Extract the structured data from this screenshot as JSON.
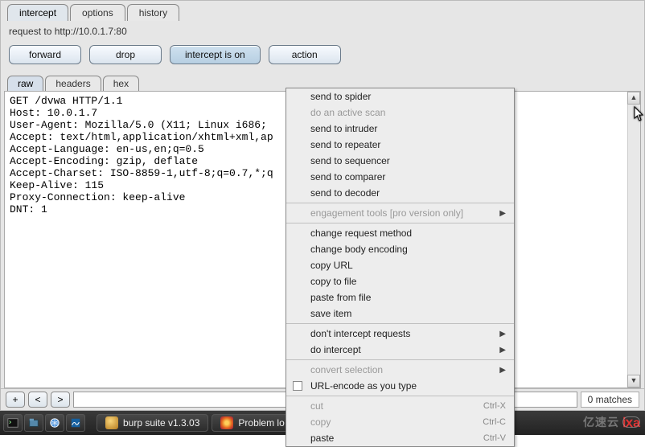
{
  "topTabs": {
    "intercept": "intercept",
    "options": "options",
    "history": "history"
  },
  "requestLine": "request to http://10.0.1.7:80",
  "buttons": {
    "forward": "forward",
    "drop": "drop",
    "intercept": "intercept is on",
    "action": "action"
  },
  "innerTabs": {
    "raw": "raw",
    "headers": "headers",
    "hex": "hex"
  },
  "rawRequest": "GET /dvwa HTTP/1.1\nHost: 10.0.1.7\nUser-Agent: Mozilla/5.0 (X11; Linux i686; \nAccept: text/html,application/xhtml+xml,ap\nAccept-Language: en-us,en;q=0.5\nAccept-Encoding: gzip, deflate\nAccept-Charset: ISO-8859-1,utf-8;q=0.7,*;q\nKeep-Alive: 115\nProxy-Connection: keep-alive\nDNT: 1\n",
  "context": {
    "spider": "send to spider",
    "activescan": "do an active scan",
    "intruder": "send to intruder",
    "repeater": "send to repeater",
    "sequencer": "send to sequencer",
    "comparer": "send to comparer",
    "decoder": "send to decoder",
    "engagement": "engagement tools [pro version only]",
    "changeMethod": "change request method",
    "changeBody": "change body encoding",
    "copyURL": "copy URL",
    "copyFile": "copy to file",
    "pasteFile": "paste from file",
    "saveItem": "save item",
    "dontIntercept": "don't intercept requests",
    "doIntercept": "do intercept",
    "convert": "convert selection",
    "urlencode": "URL-encode as you type",
    "cut": "cut",
    "copy": "copy",
    "paste": "paste",
    "sc_cut": "Ctrl-X",
    "sc_copy": "Ctrl-C",
    "sc_paste": "Ctrl-V"
  },
  "search": {
    "plus": "+",
    "prev": "<",
    "next": ">",
    "matches": "0 matches"
  },
  "taskbar": {
    "app1": "burp suite v1.3.03",
    "app2": "Problem lo"
  },
  "watermark": "亿速云"
}
